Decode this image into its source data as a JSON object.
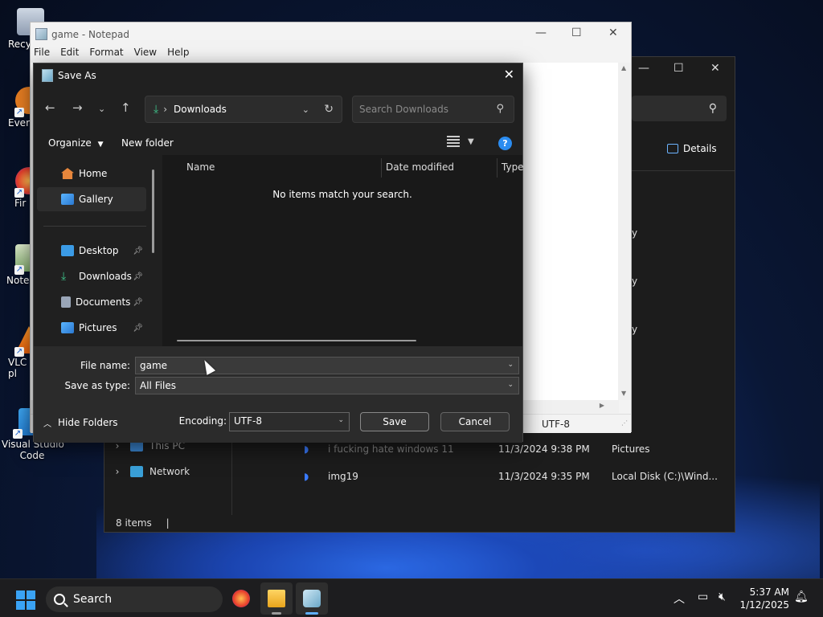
{
  "desktop": {
    "icons": [
      {
        "label": "Recy",
        "name": "recycle-bin"
      },
      {
        "label": "Ever",
        "name": "everything"
      },
      {
        "label": "Fir",
        "name": "firefox"
      },
      {
        "label": "Note",
        "name": "notepad"
      },
      {
        "label": "VLC\npl",
        "name": "vlc"
      },
      {
        "label": "Visual Studio\nCode",
        "name": "vscode"
      }
    ]
  },
  "explorer": {
    "details_label": "Details",
    "partial_texts": [
      "y",
      "y",
      "y"
    ],
    "nav": [
      {
        "label": "This PC"
      },
      {
        "label": "Network"
      }
    ],
    "rows": [
      {
        "name": "i fucking hate windows 11",
        "date": "11/3/2024 9:38 PM",
        "location": "Pictures"
      },
      {
        "name": "img19",
        "date": "11/3/2024 9:35 PM",
        "location": "Local Disk (C:)\\Wind..."
      }
    ],
    "status": "8 items"
  },
  "notepad": {
    "title": "game - Notepad",
    "menu": [
      "File",
      "Edit",
      "Format",
      "View",
      "Help"
    ],
    "encoding": "UTF-8"
  },
  "dialog": {
    "title": "Save As",
    "address": "Downloads",
    "search_placeholder": "Search Downloads",
    "organize": "Organize",
    "new_folder": "New folder",
    "nav": [
      "Home",
      "Gallery",
      "Desktop",
      "Downloads",
      "Documents",
      "Pictures"
    ],
    "columns": [
      "Name",
      "Date modified",
      "Type"
    ],
    "empty_message": "No items match your search.",
    "file_name_label": "File name:",
    "file_name_value": "game",
    "save_type_label": "Save as type:",
    "save_type_value": "All Files",
    "hide_folders": "Hide Folders",
    "encoding_label": "Encoding:",
    "encoding_value": "UTF-8",
    "save": "Save",
    "cancel": "Cancel"
  },
  "taskbar": {
    "search": "Search",
    "time": "5:37 AM",
    "date": "1/12/2025"
  }
}
